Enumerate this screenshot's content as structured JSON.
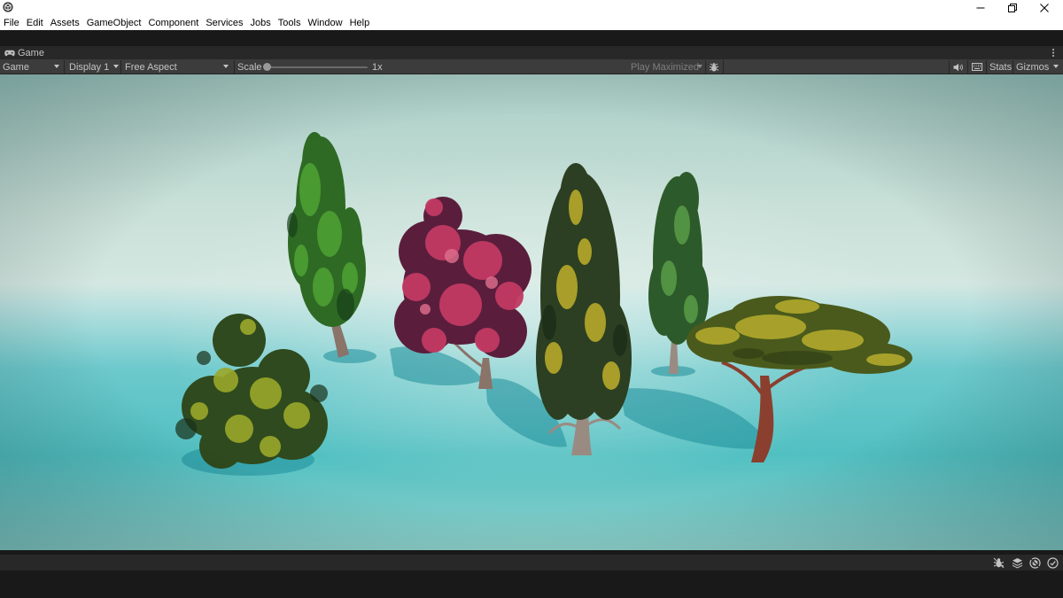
{
  "menu": {
    "items": [
      "File",
      "Edit",
      "Assets",
      "GameObject",
      "Component",
      "Services",
      "Jobs",
      "Tools",
      "Window",
      "Help"
    ]
  },
  "window_controls": [
    "minimize-icon",
    "restore-icon",
    "close-icon"
  ],
  "tab": {
    "label": "Game",
    "icon": "gamepad-icon"
  },
  "toolbar": {
    "view_mode": "Game",
    "display": "Display 1",
    "aspect": "Free Aspect",
    "scale_label": "Scale",
    "scale_value": "1x",
    "scale_fraction": 0.0,
    "play_mode": "Play Maximized",
    "stats_label": "Stats",
    "gizmos_label": "Gizmos"
  },
  "status_icons": [
    "debug-icon",
    "layers-icon",
    "shield-icon",
    "check-circle-icon"
  ],
  "colors": {
    "menubar": "#ffffff",
    "panel": "#282828",
    "toolbar": "#3c3c3c",
    "background": "#191919",
    "foliage_pink": "#c23a63",
    "foliage_green": "#3f8f2c",
    "foliage_yellow": "#b6a92a",
    "ground": "#3fb8be"
  }
}
